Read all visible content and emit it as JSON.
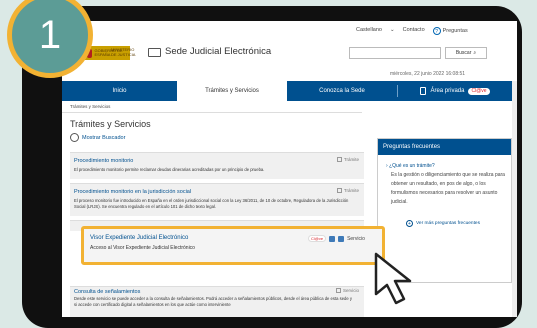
{
  "step_badge": "1",
  "header": {
    "logo_text_1": "GOBIERNO DE ESPAÑA",
    "logo_text_2": "MINISTERIO DE JUSTICIA",
    "site_title": "Sede Judicial Electrónica",
    "util_links": [
      "Castellano",
      "Contacto",
      "Preguntas"
    ],
    "search_placeholder": "",
    "search_button": "Buscar",
    "datetime": "miércoles, 22 junio 2022   16:08:51"
  },
  "nav": {
    "items": [
      "Inicio",
      "Trámites y Servicios",
      "Conozca la Sede",
      "Área privada"
    ],
    "clave_badge": "Cl@ve"
  },
  "breadcrumb": "Trámites y Servicios",
  "main": {
    "title": "Trámites y Servicios",
    "buscador": "Mostrar Buscador",
    "items": [
      {
        "title": "Procedimiento monitorio",
        "desc": "El procedimiento monitorio permite reclamar deudas dinerarias acreditadas por un principio de prueba.",
        "tag": "Trámite"
      },
      {
        "title": "Procedimiento monitorio en la jurisdicción social",
        "desc": "El proceso monitorio fue introducido en España en el orden jurisdiccional social con la Ley 36/2011, de 10 de octubre, Reguladora de la Jurisdicción Social (LRJS). Se encuentra regulado en el artículo 101 de dicho texto legal.",
        "tag": "Trámite"
      },
      {
        "title": "Consulta de señalamientos",
        "desc": "Desde este servicio se puede acceder a la consulta de señalamientos. Podrá acceder a señalamientos públicos, desde el área pública de esta sede y si accede con certificado digital a señalamientos en los que actúe como interviniente",
        "tag": "Servicio"
      }
    ],
    "highlighted": {
      "title": "Visor Expediente Judicial Electrónico",
      "desc": "Acceso al Visor Expediente Judicial Electrónico",
      "clave": "Cl@ve",
      "tag": "Servicio"
    }
  },
  "sidebar": {
    "heading": "Preguntas frecuentes",
    "question": "¿Qué es un trámite?",
    "answer": "Es la gestión o diligenciamiento que se realiza para obtener un resultado, en pos de algo, o los formulismos necesarios para resolver un asunto judicial.",
    "more": "Ver más preguntas frecuentes"
  },
  "colors": {
    "nav_blue": "#00508f",
    "highlight_border": "#f2b233",
    "badge_fill": "#5c9c96",
    "background": "#dbe9e6"
  }
}
